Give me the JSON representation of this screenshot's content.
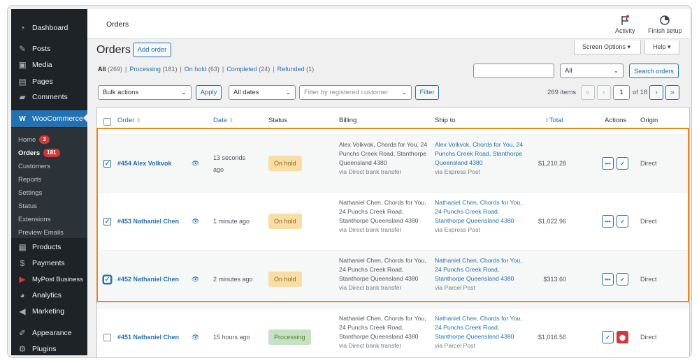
{
  "sidebar": {
    "items": [
      {
        "label": "Dashboard",
        "icon": "dashboard-icon"
      },
      {
        "label": "Posts",
        "icon": "pin-icon"
      },
      {
        "label": "Media",
        "icon": "media-icon"
      },
      {
        "label": "Pages",
        "icon": "page-icon"
      },
      {
        "label": "Comments",
        "icon": "comment-icon"
      },
      {
        "label": "WooCommerce",
        "icon": "woocommerce-icon"
      }
    ],
    "submenu": [
      {
        "label": "Home",
        "badge": "3"
      },
      {
        "label": "Orders",
        "badge": "181"
      },
      {
        "label": "Customers"
      },
      {
        "label": "Reports"
      },
      {
        "label": "Settings"
      },
      {
        "label": "Status"
      },
      {
        "label": "Extensions"
      },
      {
        "label": "Preview Emails"
      }
    ],
    "lower_items": [
      {
        "label": "Products",
        "icon": "products-icon"
      },
      {
        "label": "Payments",
        "icon": "payments-icon"
      },
      {
        "label": "MyPost Business",
        "icon": "mypost-icon"
      },
      {
        "label": "Analytics",
        "icon": "analytics-icon"
      },
      {
        "label": "Marketing",
        "icon": "marketing-icon"
      },
      {
        "label": "Appearance",
        "icon": "appearance-icon"
      },
      {
        "label": "Plugins",
        "icon": "plugins-icon"
      }
    ]
  },
  "topbar": {
    "breadcrumb": "Orders",
    "activity_label": "Activity",
    "finish_setup_label": "Finish setup"
  },
  "screen_options_label": "Screen Options ▾",
  "help_label": "Help ▾",
  "page_title": "Orders",
  "add_order_label": "Add order",
  "status_filters": [
    {
      "label": "All",
      "count": "(269)"
    },
    {
      "label": "Processing",
      "count": "(181)"
    },
    {
      "label": "On hold",
      "count": "(63)"
    },
    {
      "label": "Completed",
      "count": "(24)"
    },
    {
      "label": "Refunded",
      "count": "(1)"
    }
  ],
  "search": {
    "status_select": "All",
    "button": "Search orders"
  },
  "toolbar": {
    "bulk_actions": "Bulk actions",
    "apply": "Apply",
    "dates": "All dates",
    "customer_placeholder": "Filter by registered customer",
    "filter": "Filter",
    "items_count": "269 items",
    "current_page": "1",
    "of_pages": "of 18"
  },
  "columns": {
    "order": "Order",
    "date": "Date",
    "status": "Status",
    "billing": "Billing",
    "ship_to": "Ship to",
    "total": "Total",
    "actions": "Actions",
    "origin": "Origin"
  },
  "orders": [
    {
      "name": "#454 Alex Volkvok",
      "date": "13 seconds ago",
      "status": "On hold",
      "billing": "Alex Volkvok, Chords for You, 24 Punchs Creek Road, Stanthorpe Queensland 4380",
      "billing_via": "via Direct bank transfer",
      "ship": "Alex Volkvok, Chords for You, 24 Punchs Creek Road, Stanthorpe Queensland 4380",
      "ship_via": "via Express Post",
      "total": "$1,210.28",
      "origin": "Direct",
      "checked": true
    },
    {
      "name": "#453 Nathaniel Chen",
      "date": "1 minute ago",
      "status": "On hold",
      "billing": "Nathaniel Chen, Chords for You, 24 Punchs Creek Road, Stanthorpe Queensland 4380",
      "billing_via": "via Direct bank transfer",
      "ship": "Nathaniel Chen, Chords for You, 24 Punchs Creek Road, Stanthorpe Queensland 4380",
      "ship_via": "via Express Post",
      "total": "$1,022.96",
      "origin": "Direct",
      "checked": true
    },
    {
      "name": "#452 Nathaniel Chen",
      "date": "2 minutes ago",
      "status": "On hold",
      "billing": "Nathaniel Chen, Chords for You, 24 Punchs Creek Road, Stanthorpe Queensland 4380",
      "billing_via": "via Direct bank transfer",
      "ship": "Nathaniel Chen, Chords for You, 24 Punchs Creek Road, Stanthorpe Queensland 4380",
      "ship_via": "via Parcel Post",
      "total": "$313.60",
      "origin": "Direct",
      "checked": true
    },
    {
      "name": "#451 Nathaniel Chen",
      "date": "15 hours ago",
      "status": "Processing",
      "billing": "Nathaniel Chen, Chords for You, 24 Punchs Creek Road, Stanthorpe Queensland 4380",
      "billing_via": "via Direct bank transfer",
      "ship": "Nathaniel Chen, Chords for You, 24 Punchs Creek Road, Stanthorpe Queensland 4380",
      "ship_via": "via Parcel Post",
      "total": "$1,016.56",
      "origin": "Direct",
      "checked": false
    }
  ],
  "colors": {
    "accent": "#2271b1",
    "sidebar": "#1d2327",
    "highlight": "#f0861b",
    "on_hold_bg": "#f8dda7",
    "processing_bg": "#c6e1c6"
  }
}
